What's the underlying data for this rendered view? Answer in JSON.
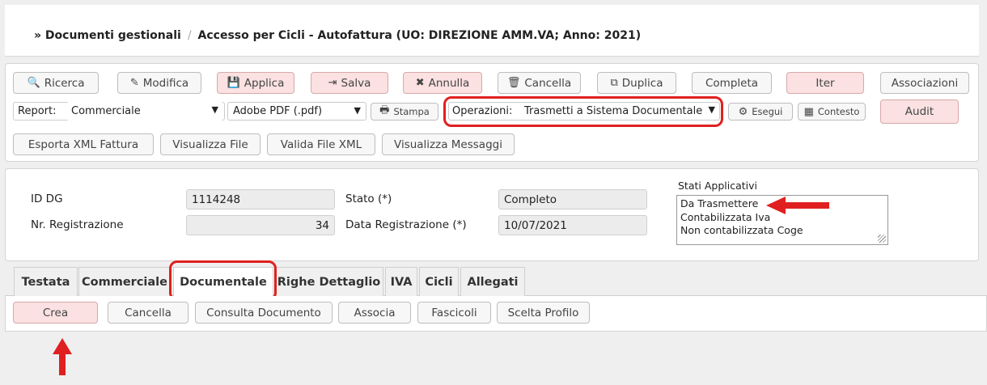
{
  "breadcrumb": {
    "prefix": "» Documenti gestionali",
    "separator": "/",
    "current": "Accesso per Cicli - Autofattura (UO: DIREZIONE AMM.VA; Anno: 2021)"
  },
  "toolbar": {
    "ricerca": "Ricerca",
    "modifica": "Modifica",
    "applica": "Applica",
    "salva": "Salva",
    "annulla": "Annulla",
    "cancella": "Cancella",
    "duplica": "Duplica",
    "completa": "Completa",
    "iter": "Iter",
    "associazioni": "Associazioni",
    "report_label": "Report:",
    "report_value": "Commerciale",
    "format_value": "Adobe PDF (.pdf)",
    "stampa": "Stampa",
    "operazioni_label": "Operazioni:",
    "operazioni_value": "Trasmetti a Sistema Documentale",
    "esegui": "Esegui",
    "contesto": "Contesto",
    "audit": "Audit",
    "esporta_xml": "Esporta XML Fattura",
    "visualizza_file": "Visualizza File",
    "valida_xml": "Valida File XML",
    "visualizza_messaggi": "Visualizza Messaggi"
  },
  "info": {
    "id_dg_label": "ID DG",
    "id_dg_value": "1114248",
    "nr_reg_label": "Nr. Registrazione",
    "nr_reg_value": "34",
    "stato_label": "Stato (*)",
    "stato_value": "Completo",
    "data_reg_label": "Data Registrazione (*)",
    "data_reg_value": "10/07/2021",
    "stati_label": "Stati Applicativi",
    "stati": [
      "Da Trasmettere",
      "Contabilizzata Iva",
      "Non contabilizzata Coge"
    ]
  },
  "tabs": [
    "Testata",
    "Commerciale",
    "Documentale",
    "Righe Dettaglio",
    "IVA",
    "Cicli",
    "Allegati"
  ],
  "actions": {
    "crea": "Crea",
    "cancella": "Cancella",
    "consulta": "Consulta Documento",
    "associa": "Associa",
    "fascicoli": "Fascicoli",
    "scelta_profilo": "Scelta Profilo"
  },
  "colors": {
    "highlight": "#e02020",
    "pink_button": "#fbe1e1"
  }
}
